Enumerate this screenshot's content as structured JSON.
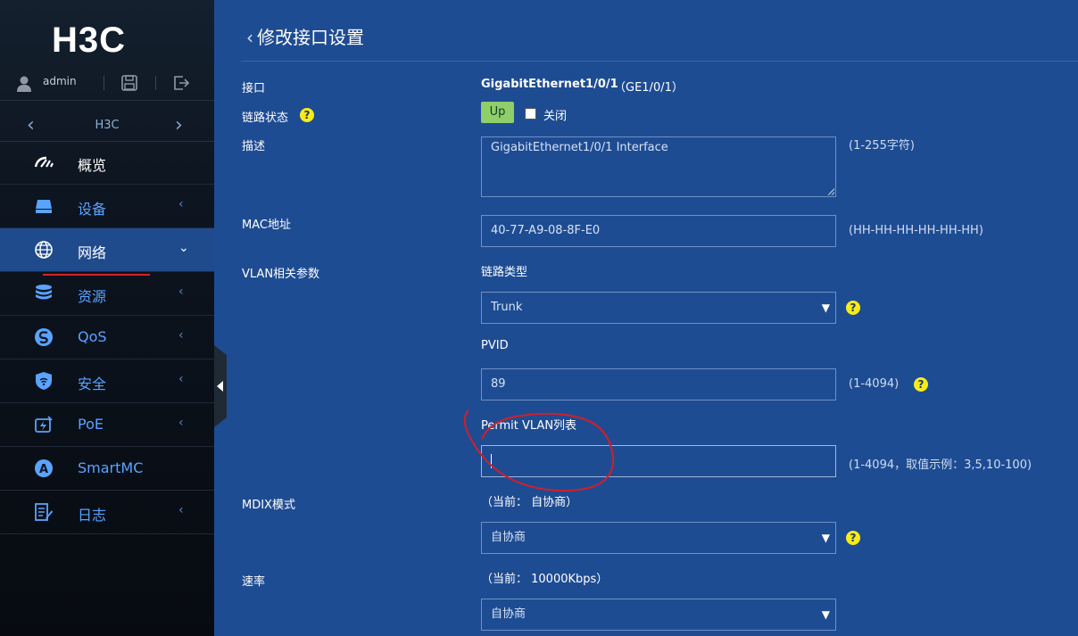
{
  "sidebar": {
    "logo_text": "H3C",
    "user": "admin",
    "device": "H3C",
    "menu": [
      {
        "label": "概览",
        "icon": "dashboard-icon",
        "arrow": ""
      },
      {
        "label": "设备",
        "icon": "device-icon",
        "arrow": "‹"
      },
      {
        "label": "网络",
        "icon": "globe-icon",
        "arrow": "⌄"
      },
      {
        "label": "资源",
        "icon": "database-icon",
        "arrow": "‹"
      },
      {
        "label": "QoS",
        "icon": "qos-icon",
        "arrow": "‹"
      },
      {
        "label": "安全",
        "icon": "shield-icon",
        "arrow": "‹"
      },
      {
        "label": "PoE",
        "icon": "poe-icon",
        "arrow": "‹"
      },
      {
        "label": "SmartMC",
        "icon": "smartmc-icon",
        "arrow": ""
      },
      {
        "label": "日志",
        "icon": "log-icon",
        "arrow": "‹"
      }
    ],
    "active_index": 2
  },
  "page": {
    "title": "修改接口设置"
  },
  "form": {
    "interface": {
      "label": "接口",
      "value": "GigabitEthernet1/0/1",
      "short": "（GE1/0/1）"
    },
    "link_state": {
      "label": "链路状态",
      "status": "Up",
      "close_label": "关闭"
    },
    "description": {
      "label": "描述",
      "value": "GigabitEthernet1/0/1 Interface",
      "hint": "(1-255字符)"
    },
    "mac": {
      "label": "MAC地址",
      "value": "40-77-A9-08-8F-E0",
      "hint": "(HH-HH-HH-HH-HH-HH)"
    },
    "vlan": {
      "label": "VLAN相关参数",
      "link_type_label": "链路类型",
      "link_type_value": "Trunk",
      "pvid_label": "PVID",
      "pvid_value": "89",
      "pvid_hint": "(1-4094)",
      "permit_label": "Permit VLAN列表",
      "permit_value": "",
      "permit_hint": "(1-4094，取值示例：3,5,10-100)"
    },
    "mdix": {
      "label": "MDIX模式",
      "current": "（当前：  自协商）",
      "value": "自协商"
    },
    "speed": {
      "label": "速率",
      "current": "（当前：  10000Kbps）",
      "value": "自协商"
    }
  },
  "colors": {
    "accent": "#5aa3ff",
    "background": "#1e4c93",
    "help": "#f6ec18",
    "up": "#8fce6a"
  }
}
